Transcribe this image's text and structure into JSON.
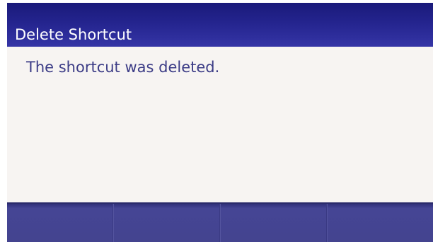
{
  "header": {
    "title": "Delete Shortcut"
  },
  "content": {
    "message": "The shortcut was deleted."
  },
  "softkeys": [
    {
      "label": ""
    },
    {
      "label": ""
    },
    {
      "label": ""
    },
    {
      "label": ""
    }
  ],
  "colors": {
    "title_bar": "#24248e",
    "content_background": "#f7f4f2",
    "message_text": "#3c3c86",
    "softkey_bar": "#44448f"
  }
}
